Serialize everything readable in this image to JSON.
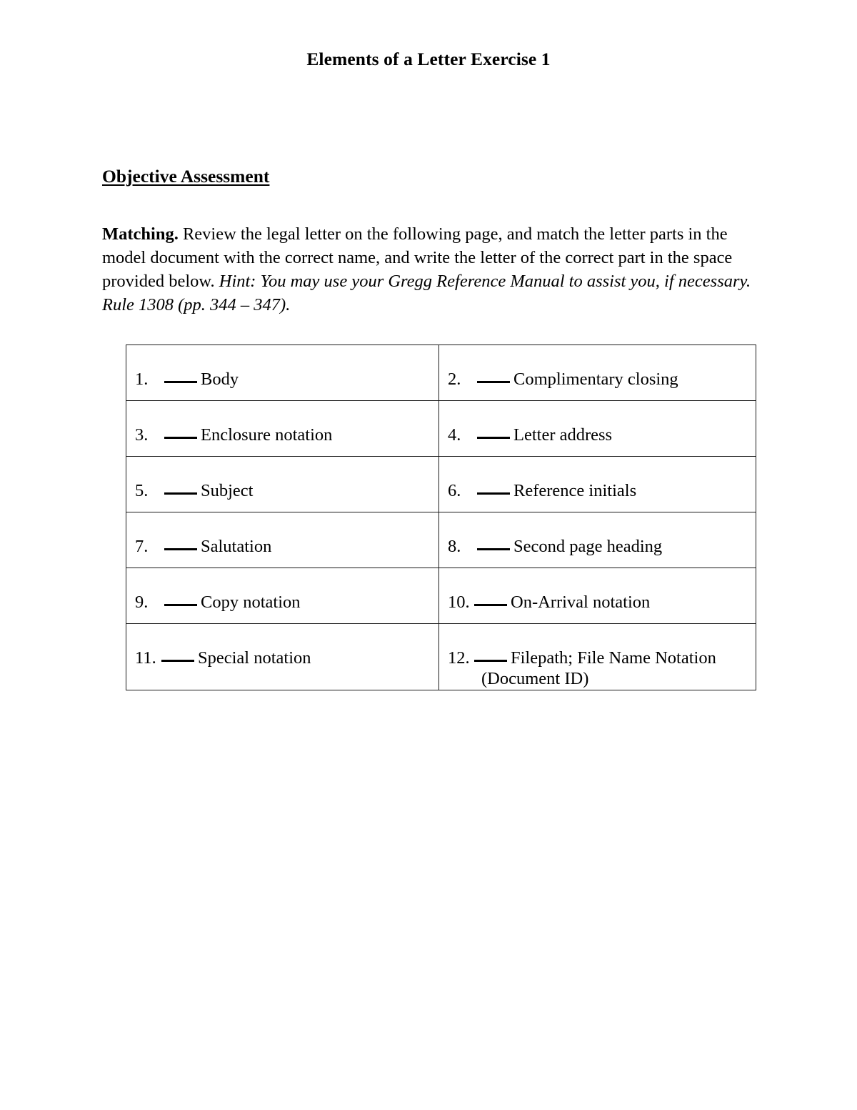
{
  "document": {
    "title": "Elements of a Letter Exercise 1",
    "section_heading": "Objective Assessment",
    "instructions": {
      "lead": "Matching.",
      "body": "  Review the legal letter on the following page, and match the letter parts in the model document with the correct name, and write the letter of the correct part in the space provided below.  ",
      "hint": "Hint:  You may use your Gregg Reference Manual to assist you, if necessary.  Rule 1308 (pp. 344 – 347)."
    }
  },
  "matching": {
    "blank_placeholder": "_____",
    "rows": [
      {
        "left": {
          "number": "1.",
          "label": "Body"
        },
        "right": {
          "number": "2.",
          "label": "Complimentary closing"
        }
      },
      {
        "left": {
          "number": "3.",
          "label": "Enclosure notation"
        },
        "right": {
          "number": "4.",
          "label": "Letter address"
        }
      },
      {
        "left": {
          "number": "5.",
          "label": "Subject"
        },
        "right": {
          "number": "6.",
          "label": "Reference initials"
        }
      },
      {
        "left": {
          "number": "7.",
          "label": "Salutation"
        },
        "right": {
          "number": "8.",
          "label": "Second page heading"
        }
      },
      {
        "left": {
          "number": "9.",
          "label": "Copy notation"
        },
        "right": {
          "number": "10.",
          "label": "On-Arrival notation"
        }
      },
      {
        "left": {
          "number": "11.",
          "label": "Special notation"
        },
        "right": {
          "number": "12.",
          "label": "Filepath; File Name Notation",
          "label_line2": "(Document ID)"
        }
      }
    ]
  }
}
